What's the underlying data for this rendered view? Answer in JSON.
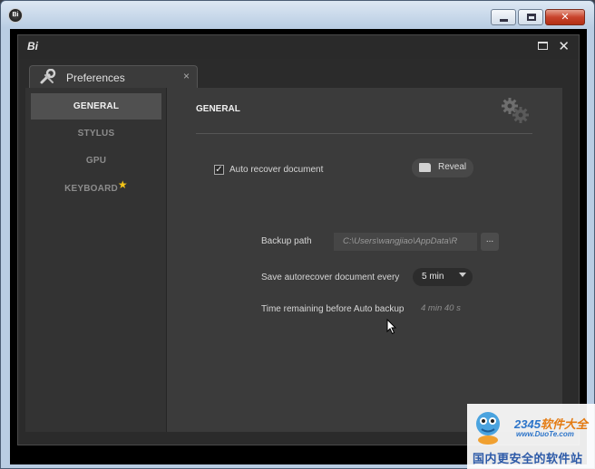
{
  "window": {
    "app_icon_label": "Bi"
  },
  "app": {
    "logo": "Bi",
    "close_glyph": "✕"
  },
  "tab": {
    "label": "Preferences",
    "close_glyph": "×"
  },
  "sidebar": {
    "items": [
      {
        "label": "GENERAL",
        "active": true
      },
      {
        "label": "STYLUS",
        "active": false
      },
      {
        "label": "GPU",
        "active": false
      },
      {
        "label": "KEYBOARD",
        "active": false,
        "badge": "★"
      }
    ]
  },
  "general": {
    "title": "GENERAL",
    "auto_recover": {
      "label": "Auto recover document",
      "checked": true,
      "check_glyph": "✓"
    },
    "reveal_label": "Reveal",
    "backup_path": {
      "label": "Backup path",
      "value": "C:\\Users\\wangjiao\\AppData\\R",
      "browse_label": "..."
    },
    "save_interval": {
      "label": "Save autorecover document every",
      "value": "5 min"
    },
    "time_remaining": {
      "label": "Time remaining before Auto backup",
      "value": "4 min 40 s"
    }
  },
  "watermark": {
    "brand_num": "2345",
    "brand_text": "软件大全",
    "url": "www.DuoTe.com",
    "slogan": "国内更安全的软件站"
  },
  "colors": {
    "accent_star": "#f5c518",
    "panel_bg": "#3b3b3b",
    "sidebar_bg": "#333333",
    "active_item_bg": "#505050"
  },
  "icons": {
    "tab": "wrench-screwdriver-icon",
    "settings": "gears-icon",
    "reveal": "folder-icon",
    "dropdown": "chevron-down-icon"
  }
}
